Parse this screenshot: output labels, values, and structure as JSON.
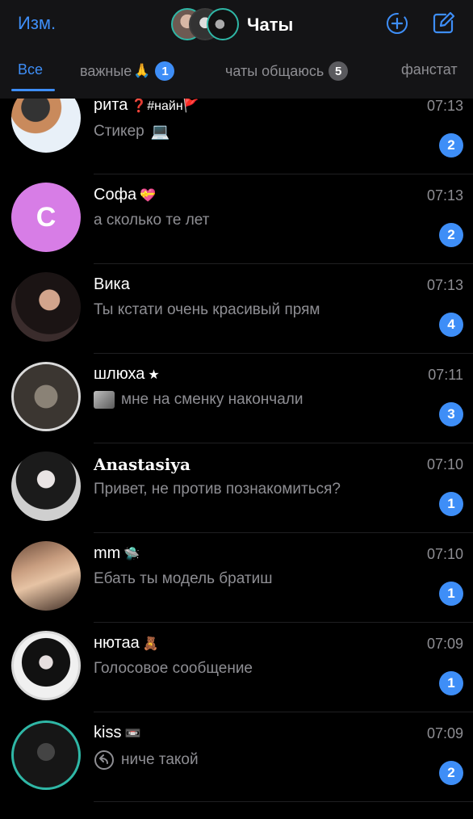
{
  "header": {
    "edit_label": "Изм.",
    "title": "Чаты",
    "accent": "#3e8ef7"
  },
  "tabs": [
    {
      "label": "Все",
      "active": true
    },
    {
      "label": "важные",
      "emoji": "🙏",
      "badge": "1"
    },
    {
      "label": "чаты общаюсь",
      "badge": "5"
    },
    {
      "label": "фанстат"
    }
  ],
  "chats": [
    {
      "name": "рита",
      "name_suffix": "❓#найн🚩",
      "time": "07:13",
      "preview": "Стикер",
      "preview_emoji": "💻",
      "unread": "2"
    },
    {
      "name": "Софа",
      "name_suffix": "💝",
      "time": "07:13",
      "preview": "а сколько те лет",
      "unread": "2",
      "avatar_letter": "С",
      "avatar_color": "#d77de6"
    },
    {
      "name": "Вика",
      "time": "07:13",
      "preview": "Ты кстати очень красивый прям",
      "unread": "4"
    },
    {
      "name": "шлюха",
      "name_suffix": "★",
      "time": "07:11",
      "preview": "мне на сменку накончали",
      "unread": "3"
    },
    {
      "name": "𝐀𝐧𝐚𝐬𝐭𝐚𝐬𝐢𝐲𝐚",
      "time": "07:10",
      "preview": "Привет, не против познакомиться?",
      "unread": "1"
    },
    {
      "name": "mm",
      "name_suffix": "🛸",
      "time": "07:10",
      "preview": "Ебать ты модель братиш",
      "unread": "1"
    },
    {
      "name": "нютаа",
      "name_suffix": "🧸",
      "time": "07:09",
      "preview": "Голосовое сообщение",
      "unread": "1"
    },
    {
      "name": "kiss",
      "name_suffix": "📼",
      "time": "07:09",
      "preview": "ниче такой",
      "unread": "2"
    }
  ]
}
